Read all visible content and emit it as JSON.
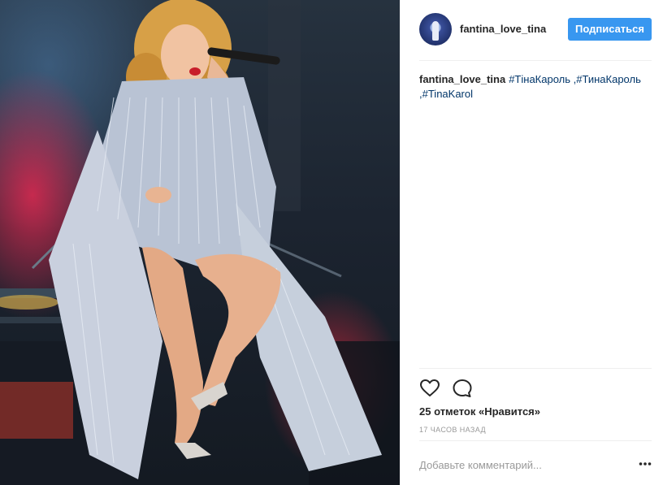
{
  "post": {
    "username": "fantina_love_tina",
    "follow_label": "Подписаться",
    "caption": {
      "user": "fantina_love_tina",
      "tags": [
        "#ТінаКароль",
        ",#ТинаКароль",
        ",#TinaKarol"
      ]
    },
    "likes": "25 отметок «Нравится»",
    "time": "17 ЧАСОВ НАЗАД",
    "comment_placeholder": "Добавьте комментарий..."
  },
  "icons": {
    "like": "heart-icon",
    "comment": "comment-icon",
    "more": "more-options-icon"
  },
  "colors": {
    "accent": "#3897f0",
    "hashtag": "#003569",
    "secondary_text": "#999999"
  }
}
